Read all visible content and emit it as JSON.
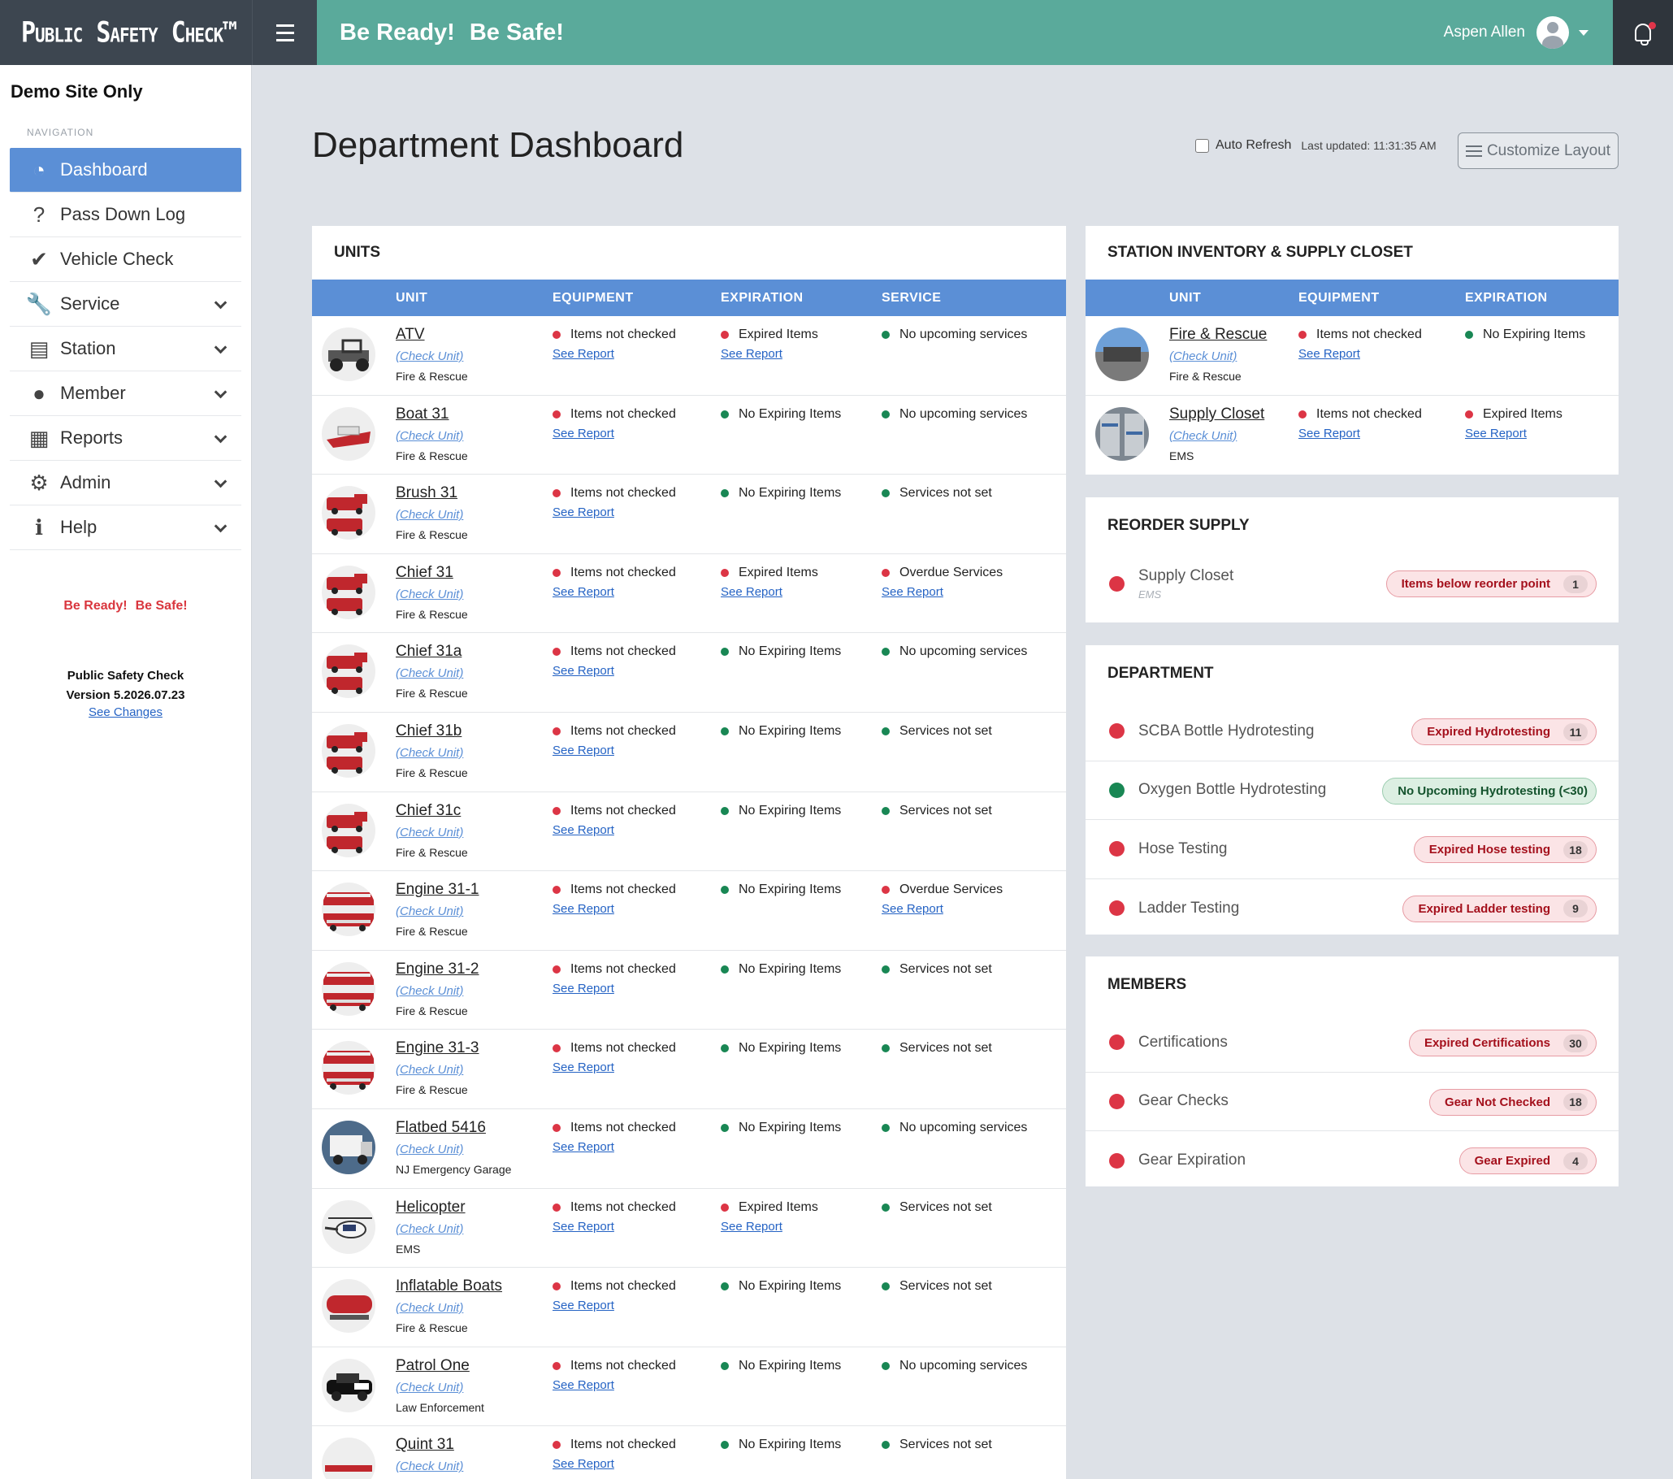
{
  "brand": "Public Safety Check™",
  "header": {
    "slogan1": "Be Ready!",
    "slogan2": "Be Safe!",
    "user_name": "Aspen Allen"
  },
  "sidebar": {
    "site_name": "Demo Site Only",
    "nav_heading": "NAVIGATION",
    "items": [
      {
        "label": "Dashboard",
        "icon": "gauge-icon"
      },
      {
        "label": "Pass Down Log",
        "icon": "question-icon"
      },
      {
        "label": "Vehicle Check",
        "icon": "check-circle-icon"
      },
      {
        "label": "Service",
        "icon": "wrench-icon"
      },
      {
        "label": "Station",
        "icon": "garage-icon"
      },
      {
        "label": "Member",
        "icon": "person-icon"
      },
      {
        "label": "Reports",
        "icon": "clipboard-icon"
      },
      {
        "label": "Admin",
        "icon": "gear-icon"
      },
      {
        "label": "Help",
        "icon": "info-icon"
      }
    ],
    "slogan1": "Be Ready!",
    "slogan2": "Be Safe!",
    "product": "Public Safety Check",
    "version": "Version 5.2026.07.23",
    "changes_link": "See Changes"
  },
  "main": {
    "title": "Department Dashboard",
    "auto_refresh": "Auto Refresh",
    "last_updated": "Last updated: 11:31:35 AM",
    "customize": "Customize Layout"
  },
  "units": {
    "title": "UNITS",
    "columns": [
      "UNIT",
      "EQUIPMENT",
      "EXPIRATION",
      "SERVICE"
    ],
    "check_label": "(Check Unit)",
    "report_label": "See Report",
    "rows": [
      {
        "name": "ATV",
        "dept": "Fire & Rescue",
        "equip": "Items not checked",
        "exp": "Expired Items",
        "exp_status": "red",
        "svc": "No upcoming services",
        "svc_status": "green"
      },
      {
        "name": "Boat 31",
        "dept": "Fire & Rescue",
        "equip": "Items not checked",
        "exp": "No Expiring Items",
        "exp_status": "green",
        "svc": "No upcoming services",
        "svc_status": "green"
      },
      {
        "name": "Brush 31",
        "dept": "Fire & Rescue",
        "equip": "Items not checked",
        "exp": "No Expiring Items",
        "exp_status": "green",
        "svc": "Services not set",
        "svc_status": "green"
      },
      {
        "name": "Chief 31",
        "dept": "Fire & Rescue",
        "equip": "Items not checked",
        "exp": "Expired Items",
        "exp_status": "red",
        "svc": "Overdue Services",
        "svc_status": "red"
      },
      {
        "name": "Chief 31a",
        "dept": "Fire & Rescue",
        "equip": "Items not checked",
        "exp": "No Expiring Items",
        "exp_status": "green",
        "svc": "No upcoming services",
        "svc_status": "green"
      },
      {
        "name": "Chief 31b",
        "dept": "Fire & Rescue",
        "equip": "Items not checked",
        "exp": "No Expiring Items",
        "exp_status": "green",
        "svc": "Services not set",
        "svc_status": "green"
      },
      {
        "name": "Chief 31c",
        "dept": "Fire & Rescue",
        "equip": "Items not checked",
        "exp": "No Expiring Items",
        "exp_status": "green",
        "svc": "Services not set",
        "svc_status": "green"
      },
      {
        "name": "Engine 31-1",
        "dept": "Fire & Rescue",
        "equip": "Items not checked",
        "exp": "No Expiring Items",
        "exp_status": "green",
        "svc": "Overdue Services",
        "svc_status": "red"
      },
      {
        "name": "Engine 31-2",
        "dept": "Fire & Rescue",
        "equip": "Items not checked",
        "exp": "No Expiring Items",
        "exp_status": "green",
        "svc": "Services not set",
        "svc_status": "green"
      },
      {
        "name": "Engine 31-3",
        "dept": "Fire & Rescue",
        "equip": "Items not checked",
        "exp": "No Expiring Items",
        "exp_status": "green",
        "svc": "Services not set",
        "svc_status": "green"
      },
      {
        "name": "Flatbed 5416",
        "dept": "NJ Emergency Garage",
        "equip": "Items not checked",
        "exp": "No Expiring Items",
        "exp_status": "green",
        "svc": "No upcoming services",
        "svc_status": "green"
      },
      {
        "name": "Helicopter",
        "dept": "EMS",
        "equip": "Items not checked",
        "exp": "Expired Items",
        "exp_status": "red",
        "svc": "Services not set",
        "svc_status": "green"
      },
      {
        "name": "Inflatable Boats",
        "dept": "Fire & Rescue",
        "equip": "Items not checked",
        "exp": "No Expiring Items",
        "exp_status": "green",
        "svc": "Services not set",
        "svc_status": "green"
      },
      {
        "name": "Patrol One",
        "dept": "Law Enforcement",
        "equip": "Items not checked",
        "exp": "No Expiring Items",
        "exp_status": "green",
        "svc": "No upcoming services",
        "svc_status": "green"
      },
      {
        "name": "Quint 31",
        "dept": "",
        "equip": "Items not checked",
        "exp": "No Expiring Items",
        "exp_status": "green",
        "svc": "Services not set",
        "svc_status": "green"
      }
    ]
  },
  "inventory": {
    "title": "STATION INVENTORY & SUPPLY CLOSET",
    "columns": [
      "UNIT",
      "EQUIPMENT",
      "EXPIRATION"
    ],
    "rows": [
      {
        "name": "Fire & Rescue",
        "dept": "Fire & Rescue",
        "equip": "Items not checked",
        "exp": "No Expiring Items",
        "exp_status": "green"
      },
      {
        "name": "Supply Closet",
        "dept": "EMS",
        "equip": "Items not checked",
        "exp": "Expired Items",
        "exp_status": "red"
      }
    ]
  },
  "reorder": {
    "title": "REORDER SUPPLY",
    "items": [
      {
        "name": "Supply Closet",
        "sub": "EMS",
        "badge": "Items below reorder point",
        "count": "1",
        "status": "red"
      }
    ]
  },
  "department": {
    "title": "DEPARTMENT",
    "items": [
      {
        "name": "SCBA Bottle Hydrotesting",
        "badge": "Expired Hydrotesting",
        "count": "11",
        "status": "red"
      },
      {
        "name": "Oxygen Bottle Hydrotesting",
        "badge": "No Upcoming Hydrotesting (<30)",
        "count": "",
        "status": "green"
      },
      {
        "name": "Hose Testing",
        "badge": "Expired Hose testing",
        "count": "18",
        "status": "red"
      },
      {
        "name": "Ladder Testing",
        "badge": "Expired Ladder testing",
        "count": "9",
        "status": "red"
      }
    ]
  },
  "members": {
    "title": "MEMBERS",
    "items": [
      {
        "name": "Certifications",
        "badge": "Expired Certifications",
        "count": "30",
        "status": "red"
      },
      {
        "name": "Gear Checks",
        "badge": "Gear Not Checked",
        "count": "18",
        "status": "red"
      },
      {
        "name": "Gear Expiration",
        "badge": "Gear Expired",
        "count": "4",
        "status": "red"
      }
    ]
  },
  "colors": {
    "accent": "#5b8fd6",
    "teal": "#5aaa9b",
    "red": "#dc3545",
    "green": "#198754",
    "dark": "#3d4650"
  }
}
